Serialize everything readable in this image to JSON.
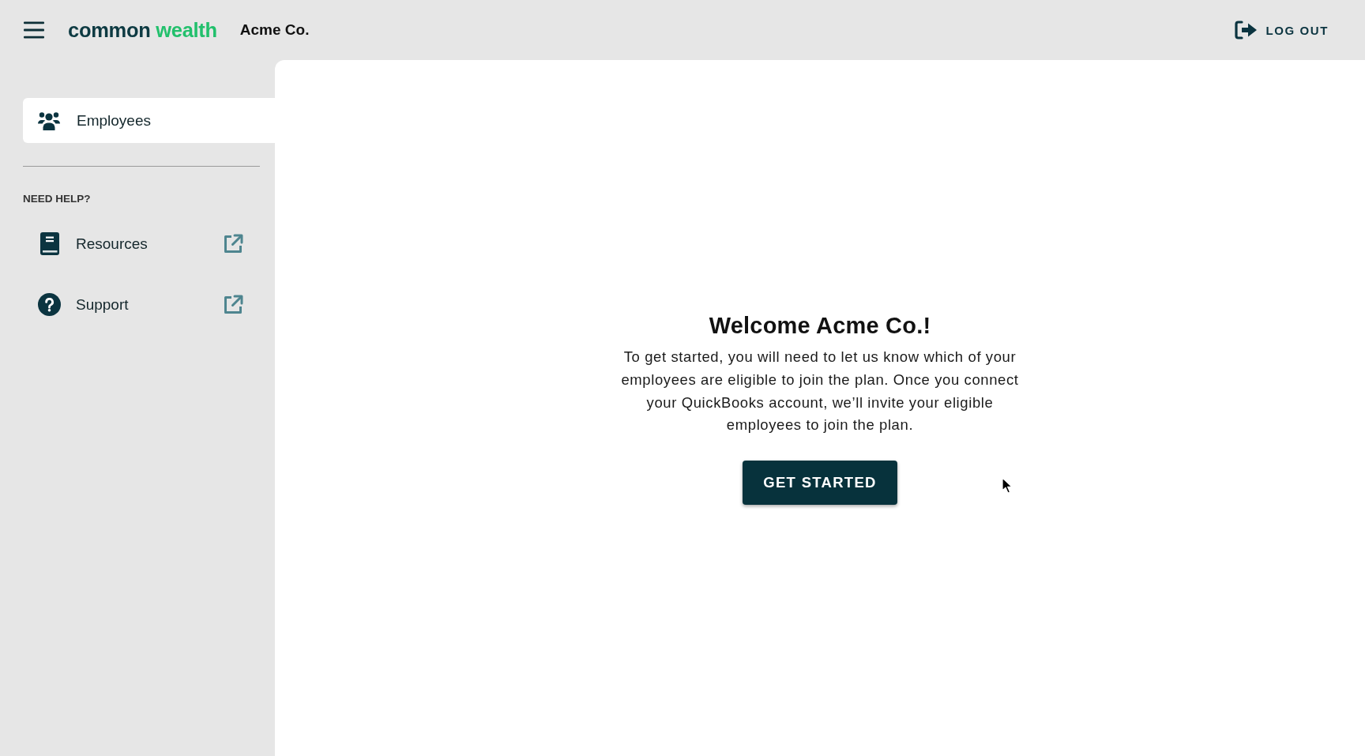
{
  "header": {
    "logo": {
      "words": [
        "common",
        "wealth"
      ]
    },
    "company": "Acme Co.",
    "logout_button": "LOG OUT"
  },
  "sidebar": {
    "nav_items": [
      {
        "label": "Employees",
        "selected": true
      }
    ],
    "help_heading": "NEED HELP?",
    "help_links": [
      {
        "label": "Resources",
        "external": true
      },
      {
        "label": "Support",
        "external": true
      }
    ]
  },
  "main": {
    "title": "Welcome Acme Co.!",
    "body": "To get started, you will need to let us know which of your employees are eligible to join the plan. Once you connect your QuickBooks account, we’ll invite your eligible employees to join the plan.",
    "button": "GET STARTED"
  }
}
